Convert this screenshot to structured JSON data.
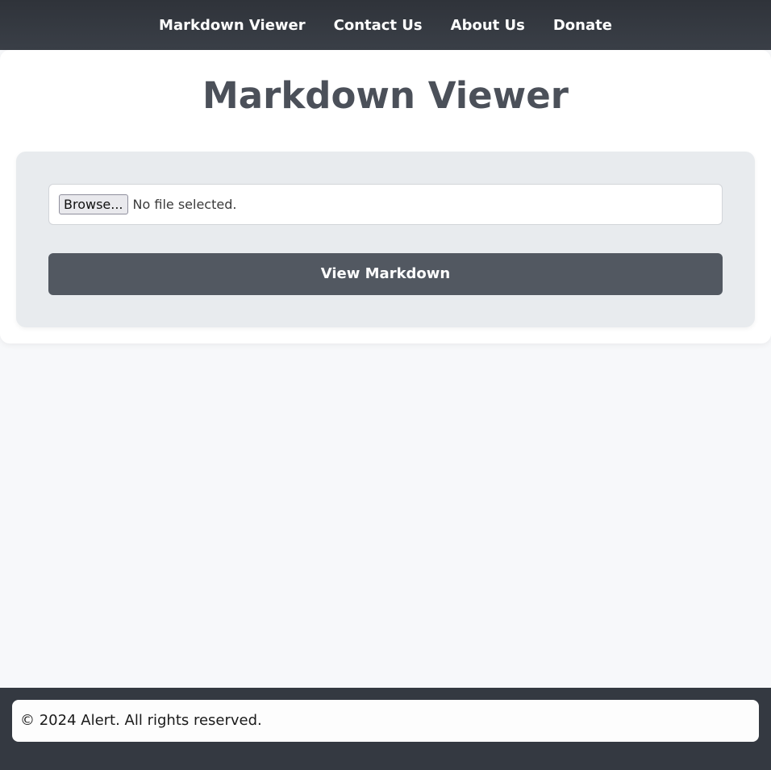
{
  "nav": {
    "items": [
      {
        "label": "Markdown Viewer"
      },
      {
        "label": "Contact Us"
      },
      {
        "label": "About Us"
      },
      {
        "label": "Donate"
      }
    ]
  },
  "main": {
    "title": "Markdown Viewer",
    "file_input": {
      "button_label": "Browse...",
      "status": "No file selected."
    },
    "submit_label": "View Markdown"
  },
  "footer": {
    "text": "© 2024 Alert. All rights reserved."
  },
  "colors": {
    "navbar": "#343941",
    "button": "#525861",
    "title": "#4b5059",
    "panel": "#e8ebee",
    "page_background": "#f7f8fa"
  }
}
